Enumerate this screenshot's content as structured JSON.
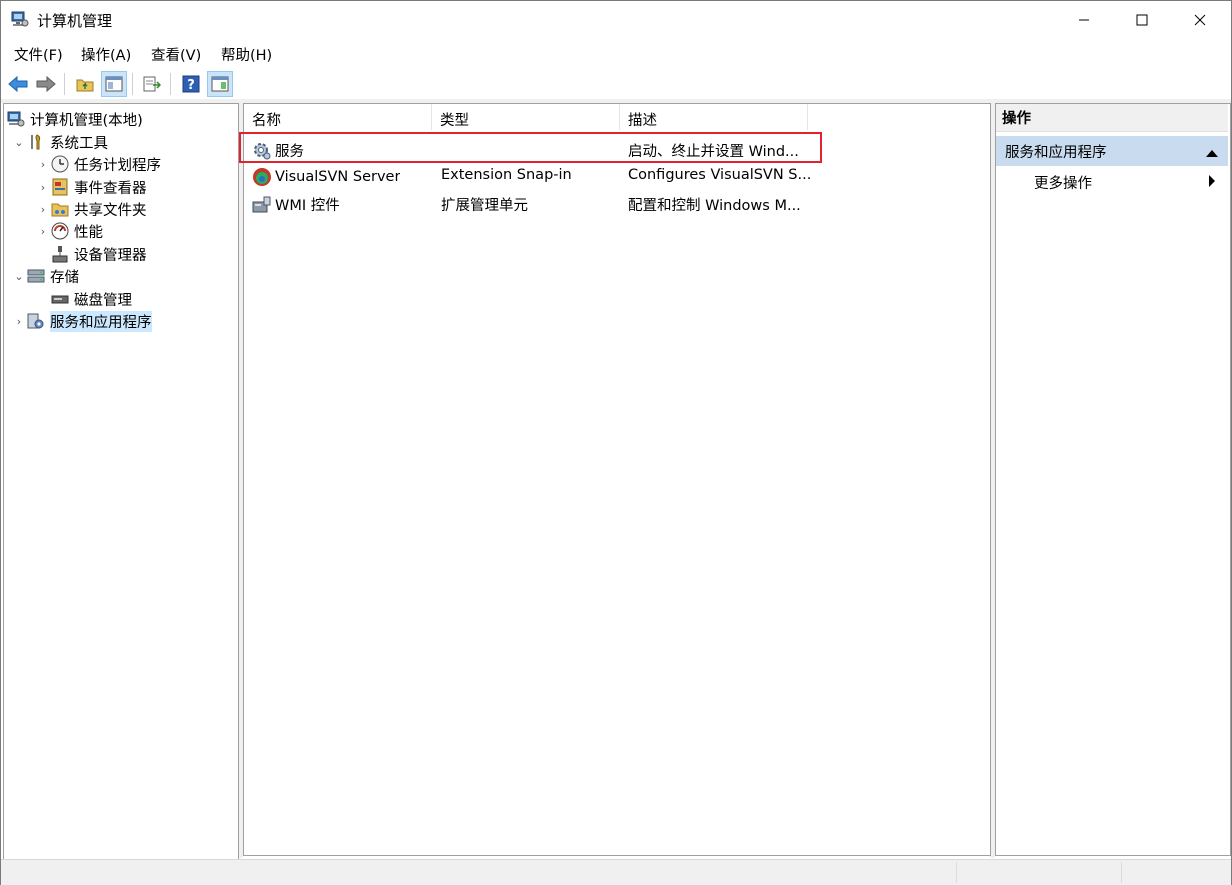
{
  "window": {
    "title": "计算机管理"
  },
  "menu": [
    "文件(F)",
    "操作(A)",
    "查看(V)",
    "帮助(H)"
  ],
  "toolbar": {
    "buttons": [
      "back-icon",
      "forward-icon",
      "up-folder-icon",
      "show-hide-tree-icon",
      "export-list-icon",
      "help-icon",
      "show-hide-action-pane-icon"
    ]
  },
  "tree": {
    "root": "计算机管理(本地)",
    "system_tools": "系统工具",
    "task_scheduler": "任务计划程序",
    "event_viewer": "事件查看器",
    "shared_folders": "共享文件夹",
    "performance": "性能",
    "device_manager": "设备管理器",
    "storage": "存储",
    "disk_management": "磁盘管理",
    "services_apps": "服务和应用程序"
  },
  "list": {
    "headers": [
      "名称",
      "类型",
      "描述"
    ],
    "rows": [
      {
        "name": "服务",
        "type": "",
        "desc": "启动、终止并设置 Wind..."
      },
      {
        "name": "VisualSVN Server",
        "type": "Extension Snap-in",
        "desc": "Configures VisualSVN S..."
      },
      {
        "name": "WMI 控件",
        "type": "扩展管理单元",
        "desc": "配置和控制 Windows M..."
      }
    ]
  },
  "actions": {
    "header": "操作",
    "section": "服务和应用程序",
    "more": "更多操作"
  },
  "colors": {
    "highlight": "#e0242f",
    "selection": "#cce8ff",
    "action_section": "#c9dcef"
  }
}
